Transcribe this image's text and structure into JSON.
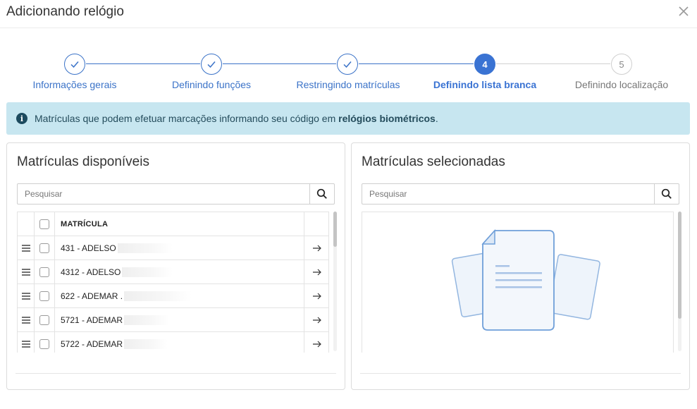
{
  "dialog": {
    "title": "Adicionando relógio"
  },
  "stepper": {
    "steps": [
      {
        "label": "Informações gerais",
        "state": "done",
        "number": "1"
      },
      {
        "label": "Definindo funções",
        "state": "done",
        "number": "2"
      },
      {
        "label": "Restringindo matrículas",
        "state": "done",
        "number": "3"
      },
      {
        "label": "Definindo lista branca",
        "state": "active",
        "number": "4"
      },
      {
        "label": "Definindo localização",
        "state": "todo",
        "number": "5"
      }
    ]
  },
  "alert": {
    "text_before": "Matrículas que podem efetuar marcações informando seu código em ",
    "text_bold": "relógios biométricos",
    "text_after": "."
  },
  "available": {
    "title": "Matrículas disponíveis",
    "search_placeholder": "Pesquisar",
    "column_header": "MATRÍCULA",
    "rows": [
      {
        "label": "431 - ADELSO"
      },
      {
        "label": "4312 - ADELSO"
      },
      {
        "label": "622 - ADEMAR ."
      },
      {
        "label": "5721 - ADEMAR"
      },
      {
        "label": "5722 - ADEMAR"
      }
    ]
  },
  "selected": {
    "title": "Matrículas selecionadas",
    "search_placeholder": "Pesquisar"
  },
  "colors": {
    "primary": "#3a73d3",
    "alert_bg": "#c7e6f0",
    "alert_text": "#244c5c"
  }
}
